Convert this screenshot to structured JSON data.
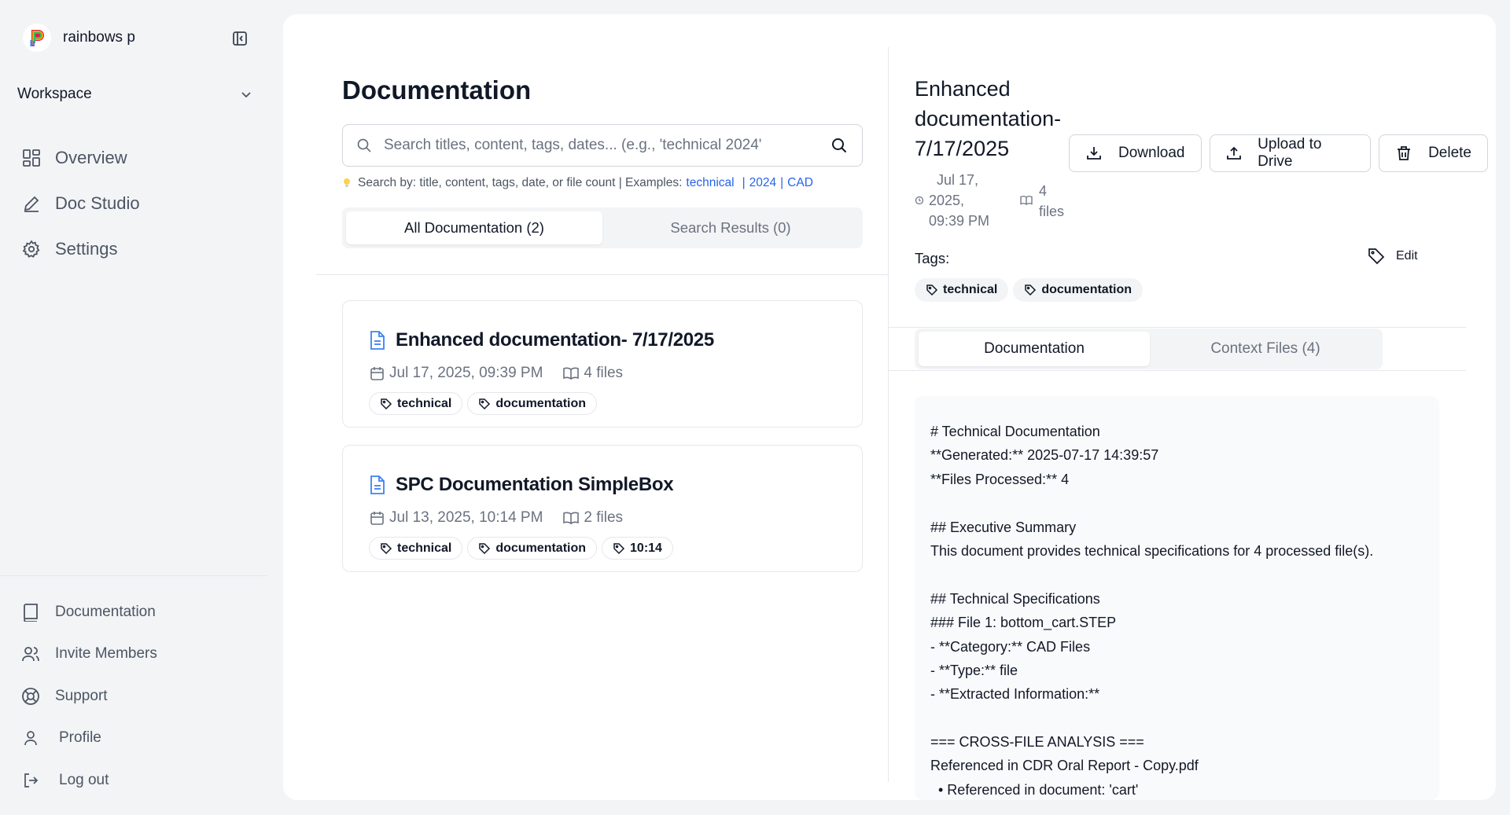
{
  "user": {
    "name": "rainbows p"
  },
  "workspace": {
    "label": "Workspace"
  },
  "nav": [
    {
      "label": "Overview",
      "icon": "overview-icon"
    },
    {
      "label": "Doc Studio",
      "icon": "pencil-icon"
    },
    {
      "label": "Settings",
      "icon": "gear-icon"
    }
  ],
  "bottom_nav": [
    {
      "label": "Documentation",
      "icon": "book-icon"
    },
    {
      "label": "Invite Members",
      "icon": "users-icon"
    },
    {
      "label": "Support",
      "icon": "lifebuoy-icon"
    },
    {
      "label": "Profile",
      "icon": "user-icon"
    },
    {
      "label": "Log out",
      "icon": "logout-icon"
    }
  ],
  "main": {
    "title": "Documentation",
    "search": {
      "placeholder": "Search titles, content, tags, dates... (e.g., 'technical 2024'",
      "value": ""
    },
    "hint": {
      "prefix": "Search by: title, content, tags, date, or file count | Examples:",
      "examples": [
        "technical",
        "2024",
        "CAD"
      ],
      "separator": "|"
    },
    "tabs": [
      {
        "label": "All Documentation (2)",
        "active": true
      },
      {
        "label": "Search Results (0)",
        "active": false
      }
    ],
    "docs": [
      {
        "title": "Enhanced documentation- 7/17/2025",
        "date": "Jul 17, 2025, 09:39 PM",
        "files": "4 files",
        "tags": [
          "technical",
          "documentation"
        ]
      },
      {
        "title": "SPC Documentation SimpleBox",
        "date": "Jul 13, 2025, 10:14 PM",
        "files": "2 files",
        "tags": [
          "technical",
          "documentation",
          "10:14"
        ]
      }
    ]
  },
  "detail": {
    "title_lines": [
      "Enhanced",
      "documentation-",
      "7/17/2025"
    ],
    "actions": {
      "download": "Download",
      "upload": "Upload to Drive",
      "delete": "Delete"
    },
    "date_lines": [
      "Jul 17,",
      "2025,",
      "09:39 PM"
    ],
    "files_lines": [
      "4",
      "files"
    ],
    "tags_label": "Tags:",
    "edit_label": "Edit",
    "tags": [
      "technical",
      "documentation"
    ],
    "tabs": [
      {
        "label": "Documentation",
        "active": true
      },
      {
        "label": "Context Files (4)",
        "active": false
      }
    ],
    "content": [
      "# Technical Documentation",
      "**Generated:** 2025-07-17 14:39:57",
      "**Files Processed:** 4",
      "",
      "## Executive Summary",
      "This document provides technical specifications for 4 processed file(s).",
      "",
      "## Technical Specifications",
      "### File 1: bottom_cart.STEP",
      "- **Category:** CAD Files",
      "- **Type:** file",
      "- **Extracted Information:**",
      "",
      "=== CROSS-FILE ANALYSIS ===",
      "Referenced in CDR Oral Report - Copy.pdf",
      "  • Referenced in document: 'cart'"
    ]
  }
}
